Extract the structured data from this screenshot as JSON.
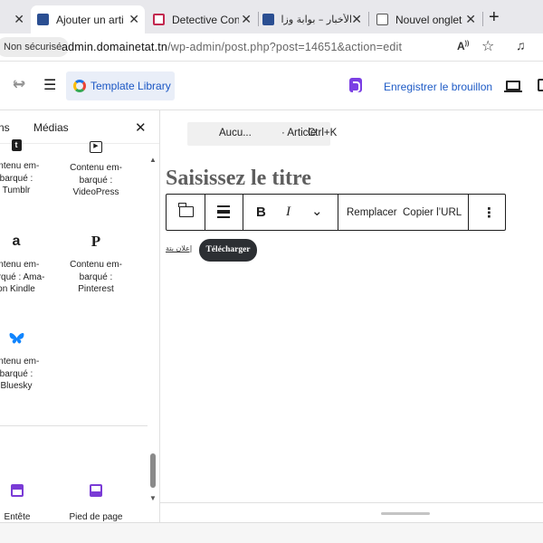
{
  "browser": {
    "tabs": [
      {
        "title": "Ajouter un article",
        "favicon": "wordpress-site-favicon",
        "active": true
      },
      {
        "title": "Detective Conan",
        "favicon": "detective-conan-favicon",
        "active": false
      },
      {
        "title": "الأخبار – بوابة وزارة",
        "favicon": "wordpress-site-favicon",
        "active": false
      },
      {
        "title": "Nouvel onglet",
        "favicon": "new-tab-favicon",
        "active": false
      }
    ],
    "close_glyph": "✕",
    "new_tab_glyph": "+",
    "security_label": "Non sécurisé",
    "url_host": "admin.domainetat.tn",
    "url_path": "/wp-admin/post.php?post=14651&action=edit"
  },
  "editor_header": {
    "template_library_label": "Template Library",
    "save_draft_label": "Enregistrer le brouillon"
  },
  "sidebar": {
    "tabs": [
      "ns",
      "Médias"
    ],
    "close_glyph": "✕",
    "blocks": [
      {
        "lines": [
          "ontenu em-",
          "barqué :",
          "Tumblr"
        ],
        "icon": "tumblr-icon",
        "glyph": "t"
      },
      {
        "lines": [
          "Contenu em-",
          "barqué :",
          "VideoPress"
        ],
        "icon": "videopress-icon",
        "glyph": "▶"
      },
      {
        "lines": [
          "ontenu em-",
          "barqué : Ama-",
          "on Kindle"
        ],
        "icon": "amazon-icon",
        "glyph": "a"
      },
      {
        "lines": [
          "Contenu em-",
          "barqué :",
          "Pinterest"
        ],
        "icon": "pinterest-icon",
        "glyph": "P"
      },
      {
        "lines": [
          "ontenu em-",
          "barqué :",
          "Bluesky"
        ],
        "icon": "bluesky-icon",
        "glyph": "🦋"
      }
    ],
    "template_parts": [
      {
        "label": "Entête",
        "icon": "header-template-icon"
      },
      {
        "label": "Pied de page",
        "icon": "footer-template-icon"
      }
    ]
  },
  "canvas": {
    "command_bar": {
      "text": "Aucu...",
      "type": "· Article",
      "shortcut": "Ctrl+K"
    },
    "title_placeholder": "Saisissez le titre",
    "toolbar": {
      "bold": "B",
      "italic": "I",
      "more_glyph": "⌄",
      "options_glyph": "⋮",
      "replace_label": "Remplacer",
      "copy_url_label": "Copier l’URL"
    },
    "image_alt": "إعلان بتة",
    "upload_label": "Télécharger"
  },
  "colors": {
    "accent_blue": "#1e5bc6",
    "plugin_purple": "#7b3fe4",
    "template_purple": "#7a3bd6",
    "upload_dark": "#2c2f33"
  }
}
